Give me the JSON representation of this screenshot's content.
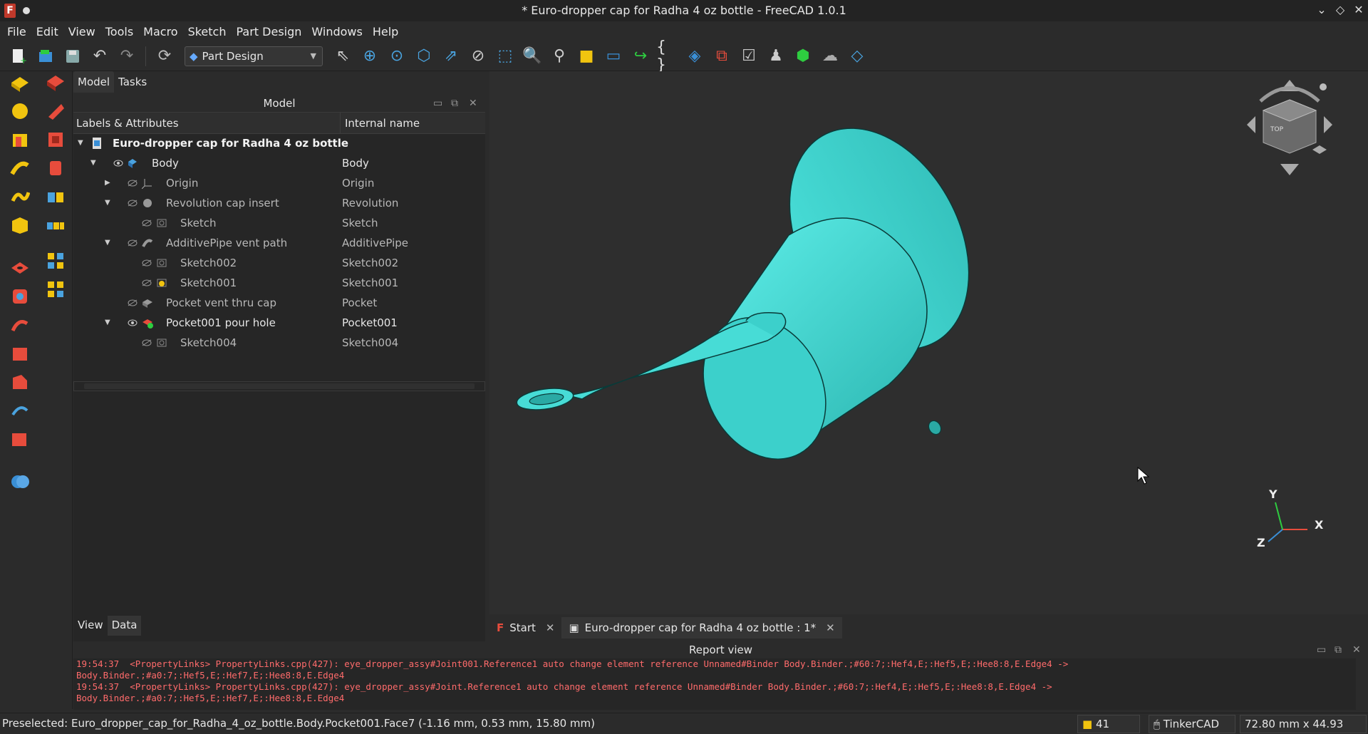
{
  "window": {
    "title": "* Euro-dropper cap for Radha 4 oz bottle - FreeCAD 1.0.1"
  },
  "menu": [
    "File",
    "Edit",
    "View",
    "Tools",
    "Macro",
    "Sketch",
    "Part Design",
    "Windows",
    "Help"
  ],
  "toolbar": {
    "workbench": "Part Design"
  },
  "combo": {
    "tabs": [
      "Model",
      "Tasks"
    ],
    "panel_title": "Model",
    "col_labels": "Labels & Attributes",
    "col_internal": "Internal name",
    "tree": [
      {
        "label": "Euro-dropper cap for Radha 4 oz bottle",
        "internal": ""
      },
      {
        "label": "Body",
        "internal": "Body"
      },
      {
        "label": "Origin",
        "internal": "Origin"
      },
      {
        "label": "Revolution cap insert",
        "internal": "Revolution"
      },
      {
        "label": "Sketch",
        "internal": "Sketch"
      },
      {
        "label": "AdditivePipe vent path",
        "internal": "AdditivePipe"
      },
      {
        "label": "Sketch002",
        "internal": "Sketch002"
      },
      {
        "label": "Sketch001",
        "internal": "Sketch001"
      },
      {
        "label": "Pocket vent thru cap",
        "internal": "Pocket"
      },
      {
        "label": "Pocket001 pour hole",
        "internal": "Pocket001"
      },
      {
        "label": "Sketch004",
        "internal": "Sketch004"
      }
    ],
    "prop_tabs": [
      "View",
      "Data"
    ]
  },
  "view3d": {
    "axes": {
      "x": "X",
      "y": "Y",
      "z": "Z"
    },
    "navcube_face": "TOP",
    "colors": {
      "model": "#3fd6d1",
      "background": "#2e2e2e"
    }
  },
  "doc_tabs": [
    {
      "label": "Start"
    },
    {
      "label": "Euro-dropper cap for Radha 4 oz bottle : 1*"
    }
  ],
  "report": {
    "title": "Report view",
    "lines": [
      "19:54:37  <PropertyLinks> PropertyLinks.cpp(427): eye_dropper_assy#Joint001.Reference1 auto change element reference Unnamed#Binder Body.Binder.;#60:7;:Hef4,E;:Hef5,E;:Hee8:8,E.Edge4 ->",
      "Body.Binder.;#a0:7;:Hef5,E;:Hef7,E;:Hee8:8,E.Edge4",
      "19:54:37  <PropertyLinks> PropertyLinks.cpp(427): eye_dropper_assy#Joint.Reference1 auto change element reference Unnamed#Binder Body.Binder.;#60:7;:Hef4,E;:Hef5,E;:Hee8:8,E.Edge4 ->",
      "Body.Binder.;#a0:7;:Hef5,E;:Hef7,E;:Hee8:8,E.Edge4"
    ]
  },
  "status": {
    "message": "Preselected: Euro_dropper_cap_for_Radha_4_oz_bottle.Body.Pocket001.Face7 (-1.16 mm, 0.53 mm, 15.80 mm)",
    "count": "41",
    "nav_style": "TinkerCAD",
    "dimensions": "72.80 mm x 44.93 mm"
  }
}
